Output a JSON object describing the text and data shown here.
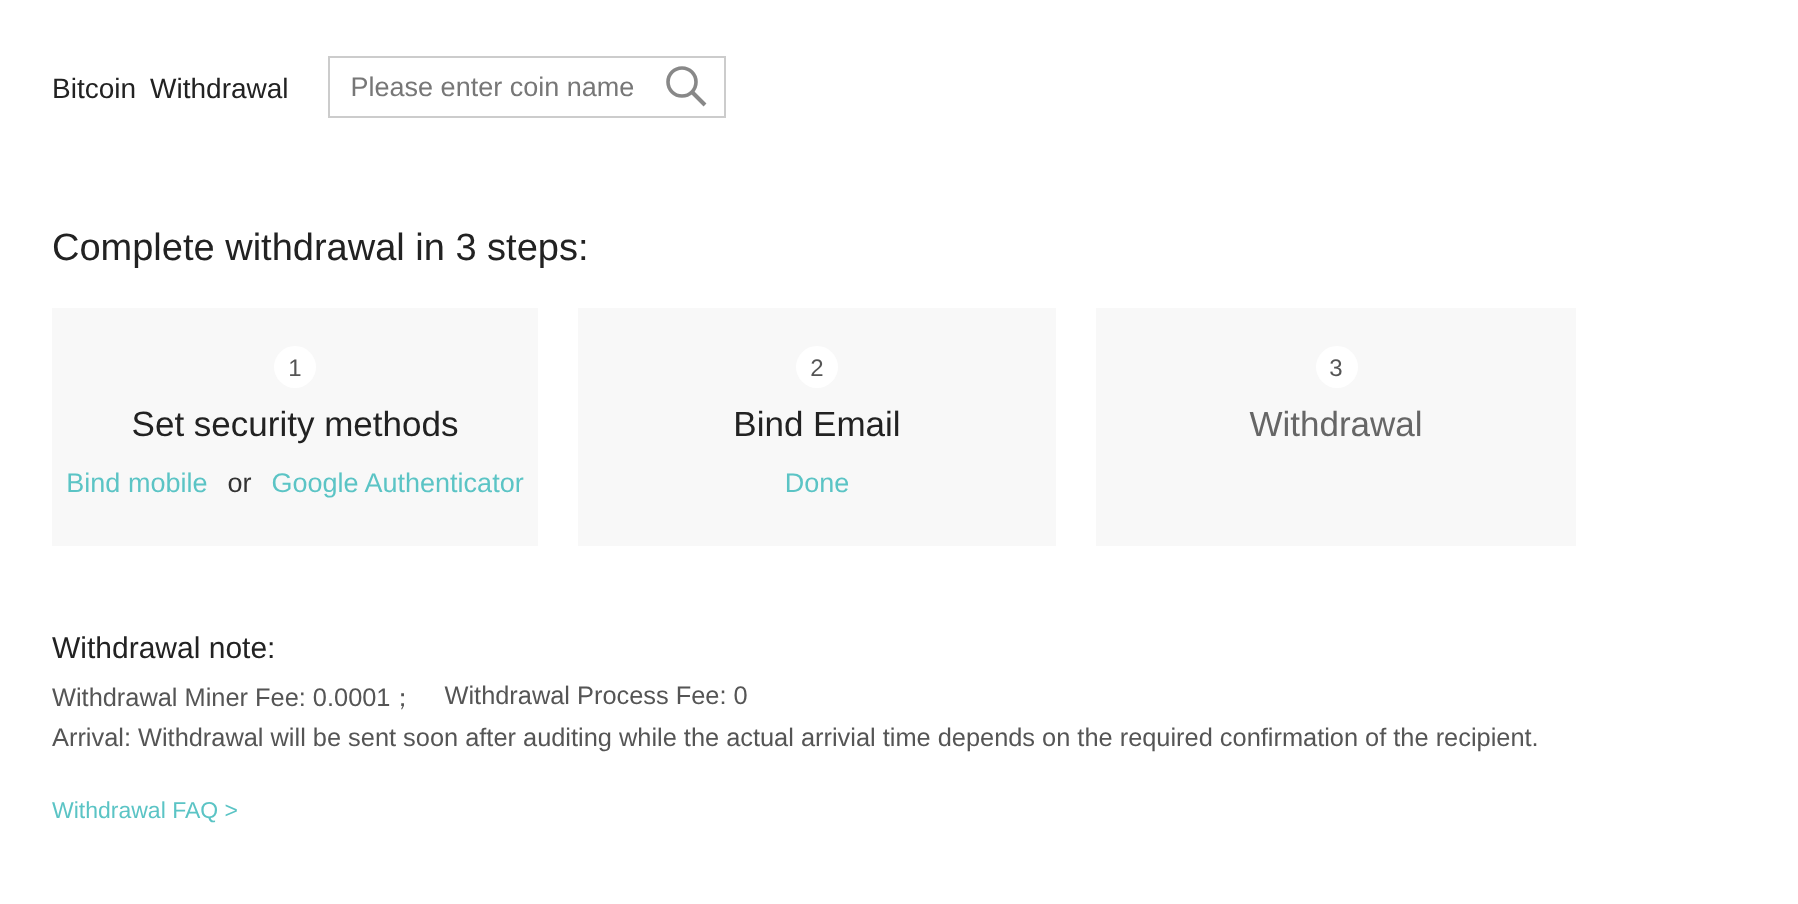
{
  "header": {
    "coin": "Bitcoin",
    "title": "Withdrawal",
    "search": {
      "placeholder": "Please enter coin name"
    }
  },
  "steps_title": "Complete withdrawal in 3 steps:",
  "steps": [
    {
      "number": "1",
      "title": "Set security methods",
      "active": true,
      "actions": [
        {
          "kind": "link",
          "text": "Bind mobile"
        },
        {
          "kind": "text",
          "text": "or"
        },
        {
          "kind": "link",
          "text": "Google Authenticator"
        }
      ]
    },
    {
      "number": "2",
      "title": "Bind Email",
      "active": true,
      "actions": [
        {
          "kind": "link",
          "text": "Done"
        }
      ]
    },
    {
      "number": "3",
      "title": "Withdrawal",
      "active": false
    }
  ],
  "note": {
    "title": "Withdrawal note:",
    "fees": [
      "Withdrawal Miner Fee: 0.0001；",
      "Withdrawal Process Fee: 0"
    ],
    "arrival": "Arrival: Withdrawal will be sent soon after auditing while the actual arrivial time depends on the required confirmation of the recipient."
  },
  "faq_link": "Withdrawal FAQ >"
}
